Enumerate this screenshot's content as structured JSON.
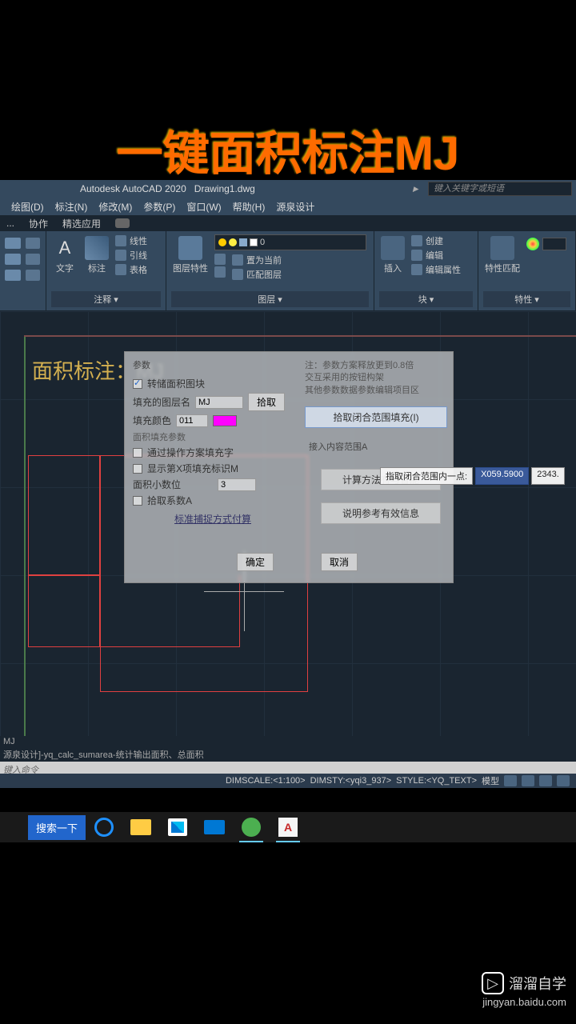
{
  "overlay_title": "一键面积标注MJ",
  "title_bar": {
    "app": "Autodesk AutoCAD 2020",
    "file": "Drawing1.dwg",
    "search_placeholder": "键入关键字或短语"
  },
  "menu": [
    "绘图(D)",
    "标注(N)",
    "修改(M)",
    "参数(P)",
    "窗口(W)",
    "帮助(H)",
    "源泉设计"
  ],
  "tabs": [
    "...",
    "协作",
    "精选应用"
  ],
  "ribbon": {
    "annot_panel": {
      "text_label": "文字",
      "dim_label": "标注",
      "lines": [
        "线性",
        "引线",
        "表格"
      ],
      "panel_title": "注释 ▾"
    },
    "layer_panel": {
      "label": "图层特性",
      "current_layer": "0",
      "items": [
        "置为当前",
        "匹配图层"
      ],
      "panel_title": "图层 ▾"
    },
    "insert_panel": {
      "insert": "插入",
      "items": [
        "创建",
        "编辑",
        "编辑属性"
      ],
      "panel_title": "块 ▾"
    },
    "props_panel": {
      "label": "特性匹配",
      "panel_title": "特性 ▾"
    }
  },
  "drawing": {
    "label": "面积标注：",
    "cmd": "MJ"
  },
  "dialog": {
    "section1": "参数",
    "cb1": "转储面积图块",
    "row1_label": "填充的图层名",
    "row1_value": "MJ",
    "btn_pick": "拾取",
    "row2_label": "填充颜色",
    "row2_value": "011",
    "section2": "面积填充参数",
    "cb2": "通过操作方案填充字",
    "cb3": "显示第X项填充标识M",
    "row3_label": "面积小数位",
    "row3_value": "3",
    "cb4": "拾取系数A",
    "link1": "标准捕捉方式付算",
    "note1": "注：参数方案释放更到0.8倍",
    "note2": "交互采用的按钮构架",
    "note3": "其他参数数据参数编辑项目区",
    "btn_wide1": "拾取闭合范围填充(I)",
    "row4_label": "接入内容范围A",
    "btn_wide2": "计算方法有与智能",
    "btn_wide3": "说明参考有效信息",
    "btn_ok": "确定",
    "btn_cancel": "取消"
  },
  "coord": {
    "label": "指取闭合范围内一点:",
    "val1": "X059.5900",
    "val2": "2343."
  },
  "command": {
    "line1": "MJ",
    "line2": "源泉设计]-yq_calc_sumarea-统计输出面积、总面积",
    "prompt": "键入命令"
  },
  "status": {
    "dimscale": "DIMSCALE:<1:100>",
    "dimsty": "DIMSTY:<yqi3_937>",
    "style": "STYLE:<YQ_TEXT>",
    "model": "模型"
  },
  "taskbar": {
    "search": "搜索一下"
  },
  "watermark": {
    "brand": "溜溜自学",
    "url": "jingyan.baidu.com"
  }
}
